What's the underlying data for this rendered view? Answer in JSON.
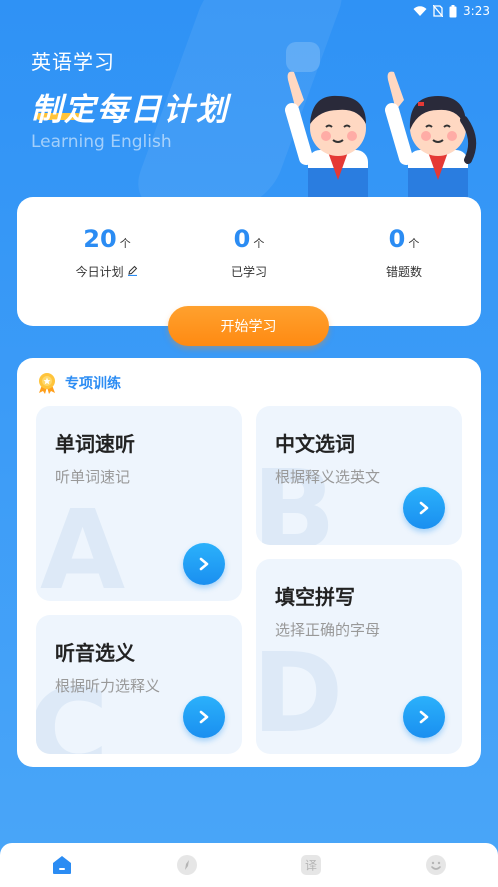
{
  "status": {
    "time": "3:23",
    "wifi_icon": "wifi-icon",
    "signal_icon": "no-sim-icon",
    "battery_icon": "battery-icon"
  },
  "header": {
    "subtitle": "英语学习",
    "title": "制定每日计划",
    "english": "Learning English",
    "accent_color": "#ffc43b"
  },
  "stats": [
    {
      "value": "20",
      "unit": "个",
      "label": "今日计划",
      "edit_icon": "edit-icon"
    },
    {
      "value": "0",
      "unit": "个",
      "label": "已学习"
    },
    {
      "value": "0",
      "unit": "个",
      "label": "错题数"
    }
  ],
  "start_button": "开始学习",
  "training": {
    "title": "专项训练",
    "icon": "medal-icon",
    "tiles": [
      {
        "title": "单词速听",
        "subtitle": "听单词速记"
      },
      {
        "title": "中文选词",
        "subtitle": "根据释义选英文"
      },
      {
        "title": "听音选义",
        "subtitle": "根据听力选释义"
      },
      {
        "title": "填空拼写",
        "subtitle": "选择正确的字母"
      }
    ]
  },
  "tabbar": [
    {
      "name": "home-icon",
      "active": true
    },
    {
      "name": "compass-icon",
      "active": false
    },
    {
      "name": "translate-icon",
      "active": false,
      "glyph": "译"
    },
    {
      "name": "smile-icon",
      "active": false
    }
  ],
  "colors": {
    "primary": "#2b8cf3",
    "orange": "#ff8a12",
    "bg": "#3b9bf7"
  }
}
